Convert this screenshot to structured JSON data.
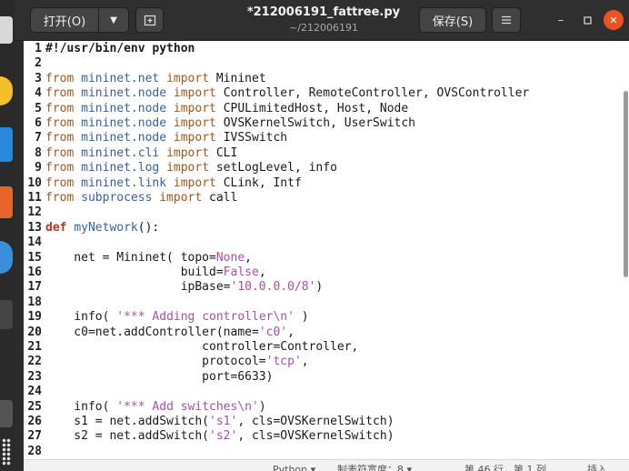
{
  "header": {
    "open_label": "打开(O)",
    "title": "*212006191_fattree.py",
    "subtitle": "~/212006191",
    "save_label": "保存(S)"
  },
  "editor": {
    "lines": [
      {
        "n": "1",
        "t": [
          [
            "sheb",
            "#!/usr/bin/env python"
          ]
        ]
      },
      {
        "n": "2",
        "t": []
      },
      {
        "n": "3",
        "t": [
          [
            "kw",
            "from "
          ],
          [
            "mod",
            "mininet.net "
          ],
          [
            "kw",
            "import "
          ],
          [
            "nm",
            "Mininet"
          ]
        ]
      },
      {
        "n": "4",
        "t": [
          [
            "kw",
            "from "
          ],
          [
            "mod",
            "mininet.node "
          ],
          [
            "kw",
            "import "
          ],
          [
            "nm",
            "Controller, RemoteController, OVSController"
          ]
        ]
      },
      {
        "n": "5",
        "t": [
          [
            "kw",
            "from "
          ],
          [
            "mod",
            "mininet.node "
          ],
          [
            "kw",
            "import "
          ],
          [
            "nm",
            "CPULimitedHost, Host, Node"
          ]
        ]
      },
      {
        "n": "6",
        "t": [
          [
            "kw",
            "from "
          ],
          [
            "mod",
            "mininet.node "
          ],
          [
            "kw",
            "import "
          ],
          [
            "nm",
            "OVSKernelSwitch, UserSwitch"
          ]
        ]
      },
      {
        "n": "7",
        "t": [
          [
            "kw",
            "from "
          ],
          [
            "mod",
            "mininet.node "
          ],
          [
            "kw",
            "import "
          ],
          [
            "nm",
            "IVSSwitch"
          ]
        ]
      },
      {
        "n": "8",
        "t": [
          [
            "kw",
            "from "
          ],
          [
            "mod",
            "mininet.cli "
          ],
          [
            "kw",
            "import "
          ],
          [
            "nm",
            "CLI"
          ]
        ]
      },
      {
        "n": "9",
        "t": [
          [
            "kw",
            "from "
          ],
          [
            "mod",
            "mininet.log "
          ],
          [
            "kw",
            "import "
          ],
          [
            "nm",
            "setLogLevel, info"
          ]
        ]
      },
      {
        "n": "10",
        "t": [
          [
            "kw",
            "from "
          ],
          [
            "mod",
            "mininet.link "
          ],
          [
            "kw",
            "import "
          ],
          [
            "nm",
            "CLink, Intf"
          ]
        ]
      },
      {
        "n": "11",
        "t": [
          [
            "kw",
            "from "
          ],
          [
            "mod",
            "subprocess "
          ],
          [
            "kw",
            "import "
          ],
          [
            "nm",
            "call"
          ]
        ]
      },
      {
        "n": "12",
        "t": []
      },
      {
        "n": "13",
        "t": [
          [
            "def",
            "def "
          ],
          [
            "mod",
            "myNetwork"
          ],
          [
            "nm",
            "():"
          ]
        ]
      },
      {
        "n": "14",
        "t": []
      },
      {
        "n": "15",
        "t": [
          [
            "nm",
            "    net = Mininet( topo="
          ],
          [
            "con",
            "None"
          ],
          [
            "nm",
            ","
          ]
        ]
      },
      {
        "n": "16",
        "t": [
          [
            "nm",
            "                   build="
          ],
          [
            "con",
            "False"
          ],
          [
            "nm",
            ","
          ]
        ]
      },
      {
        "n": "17",
        "t": [
          [
            "nm",
            "                   ipBase="
          ],
          [
            "str",
            "'10.0.0.0/8'"
          ],
          [
            "nm",
            ")"
          ]
        ]
      },
      {
        "n": "18",
        "t": []
      },
      {
        "n": "19",
        "t": [
          [
            "nm",
            "    info( "
          ],
          [
            "str",
            "'*** Adding controller\\n'"
          ],
          [
            "nm",
            " )"
          ]
        ]
      },
      {
        "n": "20",
        "t": [
          [
            "nm",
            "    c0=net.addController(name="
          ],
          [
            "str",
            "'c0'"
          ],
          [
            "nm",
            ","
          ]
        ]
      },
      {
        "n": "21",
        "t": [
          [
            "nm",
            "                      controller=Controller,"
          ]
        ]
      },
      {
        "n": "22",
        "t": [
          [
            "nm",
            "                      protocol="
          ],
          [
            "str",
            "'tcp'"
          ],
          [
            "nm",
            ","
          ]
        ]
      },
      {
        "n": "23",
        "t": [
          [
            "nm",
            "                      port=6633)"
          ]
        ]
      },
      {
        "n": "24",
        "t": []
      },
      {
        "n": "25",
        "t": [
          [
            "nm",
            "    info( "
          ],
          [
            "str",
            "'*** Add switches\\n'"
          ],
          [
            "nm",
            ")"
          ]
        ]
      },
      {
        "n": "26",
        "t": [
          [
            "nm",
            "    s1 = net.addSwitch("
          ],
          [
            "str",
            "'s1'"
          ],
          [
            "nm",
            ", cls=OVSKernelSwitch)"
          ]
        ]
      },
      {
        "n": "27",
        "t": [
          [
            "nm",
            "    s2 = net.addSwitch("
          ],
          [
            "str",
            "'s2'"
          ],
          [
            "nm",
            ", cls=OVSKernelSwitch)"
          ]
        ]
      },
      {
        "n": "28",
        "t": []
      }
    ]
  },
  "statusbar": {
    "language": "Python ▾",
    "tab_width": "制表符宽度：8 ▾",
    "position": "第 46 行，第 1 列",
    "mode": "插入"
  },
  "colors": {
    "accent": "#e95420",
    "keyword": "#a5561c",
    "module": "#3a5fa8",
    "string": "#a452a8"
  }
}
